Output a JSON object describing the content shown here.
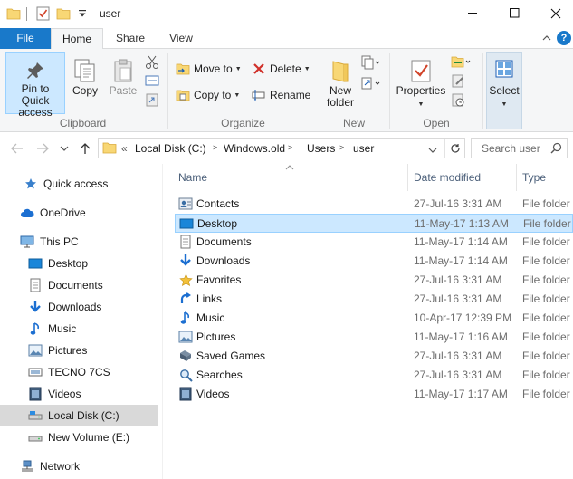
{
  "window": {
    "title": "user",
    "controls": {
      "minimize": "minimize",
      "maximize": "maximize",
      "close": "close"
    }
  },
  "ribbon_tabs": {
    "file": "File",
    "home": "Home",
    "share": "Share",
    "view": "View",
    "help": "?"
  },
  "ribbon": {
    "clipboard": {
      "label": "Clipboard",
      "pin_line1": "Pin to Quick",
      "pin_line2": "access",
      "copy": "Copy",
      "paste": "Paste"
    },
    "organize": {
      "label": "Organize",
      "move_to": "Move to",
      "copy_to": "Copy to",
      "delete": "Delete",
      "rename": "Rename"
    },
    "new": {
      "label": "New",
      "new_folder_line1": "New",
      "new_folder_line2": "folder"
    },
    "open": {
      "label": "Open",
      "properties": "Properties"
    },
    "select": {
      "label": "Select"
    }
  },
  "address": {
    "overflow": "«",
    "crumbs": [
      "Local Disk (C:)",
      "Windows.old",
      "Users",
      "user"
    ],
    "search_placeholder": "Search user"
  },
  "nav_pane": {
    "items": [
      {
        "label": "Quick access",
        "icon": "star-icon"
      },
      {
        "label": "OneDrive",
        "icon": "cloud-icon"
      },
      {
        "label": "This PC",
        "icon": "computer-icon"
      },
      {
        "label": "Desktop",
        "icon": "desktop-icon"
      },
      {
        "label": "Documents",
        "icon": "documents-icon"
      },
      {
        "label": "Downloads",
        "icon": "download-icon"
      },
      {
        "label": "Music",
        "icon": "music-icon"
      },
      {
        "label": "Pictures",
        "icon": "pictures-icon"
      },
      {
        "label": "TECNO 7CS",
        "icon": "phone-icon"
      },
      {
        "label": "Videos",
        "icon": "videos-icon"
      },
      {
        "label": "Local Disk (C:)",
        "icon": "drive-icon",
        "selected": true
      },
      {
        "label": "New Volume (E:)",
        "icon": "drive-icon"
      },
      {
        "label": "Network",
        "icon": "network-icon"
      }
    ]
  },
  "file_list": {
    "columns": {
      "name": "Name",
      "date": "Date modified",
      "type": "Type"
    },
    "rows": [
      {
        "name": "Contacts",
        "date": "27-Jul-16 3:31 AM",
        "type": "File folder",
        "icon": "contacts-icon"
      },
      {
        "name": "Desktop",
        "date": "11-May-17 1:13 AM",
        "type": "File folder",
        "icon": "desktop-icon",
        "selected": true
      },
      {
        "name": "Documents",
        "date": "11-May-17 1:14 AM",
        "type": "File folder",
        "icon": "documents-icon"
      },
      {
        "name": "Downloads",
        "date": "11-May-17 1:14 AM",
        "type": "File folder",
        "icon": "download-icon"
      },
      {
        "name": "Favorites",
        "date": "27-Jul-16 3:31 AM",
        "type": "File folder",
        "icon": "star-icon"
      },
      {
        "name": "Links",
        "date": "27-Jul-16 3:31 AM",
        "type": "File folder",
        "icon": "links-icon"
      },
      {
        "name": "Music",
        "date": "10-Apr-17 12:39 PM",
        "type": "File folder",
        "icon": "music-icon"
      },
      {
        "name": "Pictures",
        "date": "11-May-17 1:16 AM",
        "type": "File folder",
        "icon": "pictures-icon"
      },
      {
        "name": "Saved Games",
        "date": "27-Jul-16 3:31 AM",
        "type": "File folder",
        "icon": "saved-games-icon"
      },
      {
        "name": "Searches",
        "date": "27-Jul-16 3:31 AM",
        "type": "File folder",
        "icon": "search-icon"
      },
      {
        "name": "Videos",
        "date": "11-May-17 1:17 AM",
        "type": "File folder",
        "icon": "videos-icon"
      }
    ]
  },
  "colors": {
    "accent": "#1979ca",
    "selection": "#cce8ff",
    "selection_border": "#99d1ff",
    "nav_selected": "#d9d9d9",
    "ribbon_bg": "#f5f6f7",
    "header_text": "#4c607a",
    "muted_text": "#6d6d6d"
  }
}
